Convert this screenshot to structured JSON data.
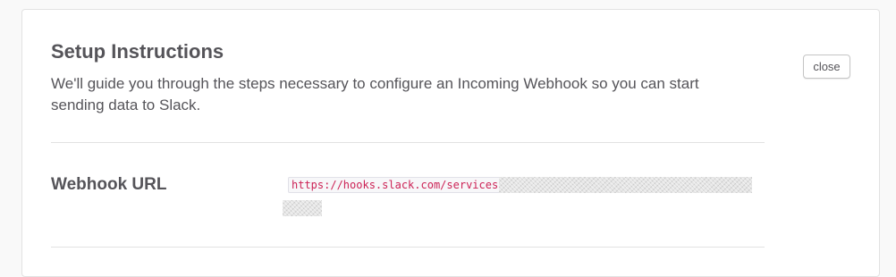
{
  "panel": {
    "title": "Setup Instructions",
    "description": "We'll guide you through the steps necessary to configure an Incoming Webhook so you can start sending data to Slack.",
    "close_label": "close"
  },
  "webhook": {
    "label": "Webhook URL",
    "url_prefix": "https://hooks.slack.com/services"
  },
  "colors": {
    "text": "#555459",
    "code_text": "#cc2255",
    "border": "#e2e2e2"
  }
}
